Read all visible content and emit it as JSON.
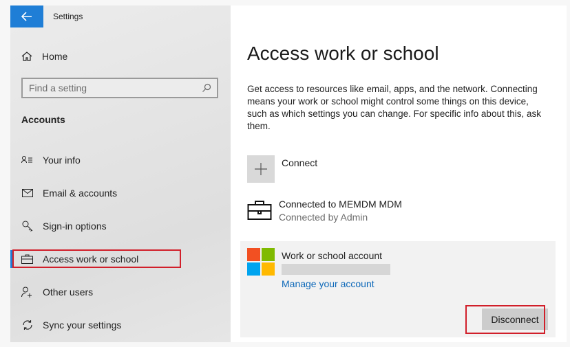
{
  "window": {
    "title": "Settings"
  },
  "sidebar": {
    "home_label": "Home",
    "search": {
      "placeholder": "Find a setting"
    },
    "section_title": "Accounts",
    "items": [
      {
        "label": "Your info",
        "icon": "person-list-icon"
      },
      {
        "label": "Email & accounts",
        "icon": "mail-icon"
      },
      {
        "label": "Sign-in options",
        "icon": "key-icon"
      },
      {
        "label": "Access work or school",
        "icon": "briefcase-icon"
      },
      {
        "label": "Other users",
        "icon": "add-person-icon"
      },
      {
        "label": "Sync your settings",
        "icon": "sync-icon"
      }
    ]
  },
  "main": {
    "title": "Access work or school",
    "description": "Get access to resources like email, apps, and the network. Connecting means your work or school might control some things on this device, such as which settings you can change. For specific info about this, ask them.",
    "connect_label": "Connect",
    "connection": {
      "title": "Connected to MEMDM MDM",
      "subtitle": "Connected by Admin"
    },
    "account": {
      "title": "Work or school account",
      "manage_link": "Manage your account",
      "disconnect_label": "Disconnect"
    }
  },
  "colors": {
    "accent": "#1f7ed6",
    "highlight": "#d11f2a",
    "ms_red": "#f25022",
    "ms_green": "#7fba00",
    "ms_blue": "#00a4ef",
    "ms_yellow": "#ffb900"
  }
}
